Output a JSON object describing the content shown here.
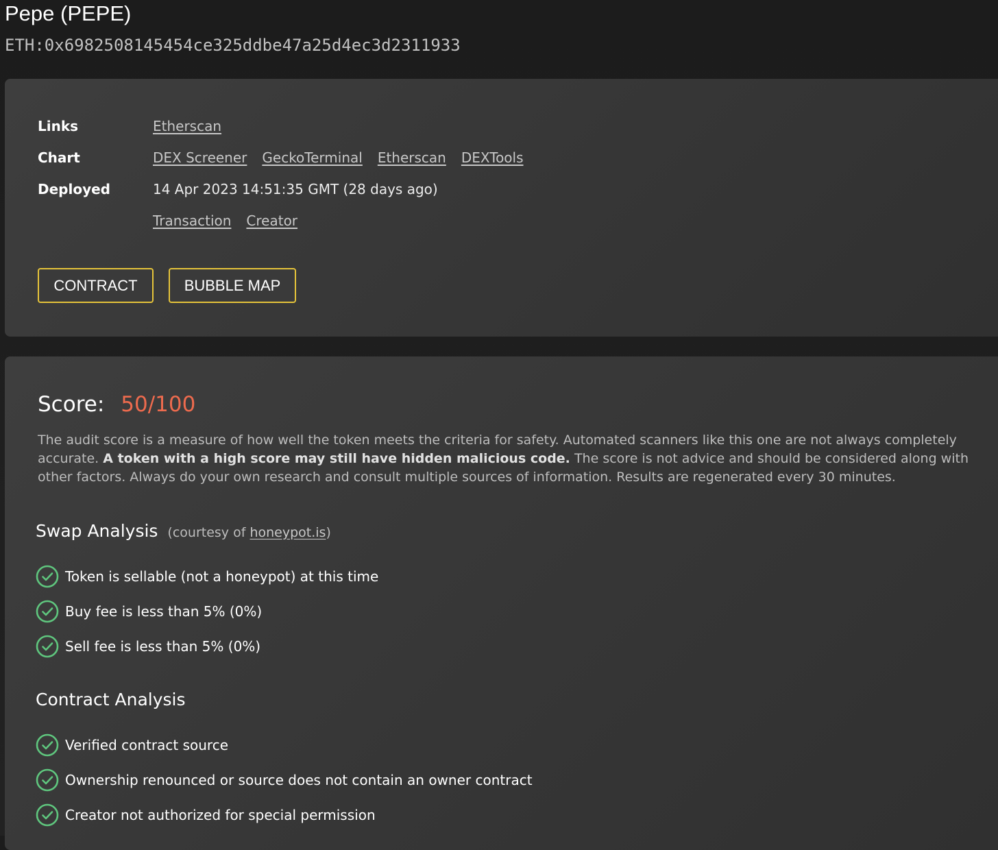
{
  "header": {
    "title": "Pepe (PEPE)",
    "address": "ETH:0x6982508145454ce325ddbe47a25d4ec3d2311933"
  },
  "info": {
    "links": {
      "label": "Links",
      "items": [
        "Etherscan"
      ]
    },
    "chart": {
      "label": "Chart",
      "items": [
        "DEX Screener",
        "GeckoTerminal",
        "Etherscan",
        "DEXTools"
      ]
    },
    "deployed": {
      "label": "Deployed",
      "value": "14 Apr 2023 14:51:35 GMT (28 days ago)",
      "links": [
        "Transaction",
        "Creator"
      ]
    }
  },
  "buttons": {
    "contract": "CONTRACT",
    "bubble_map": "BUBBLE MAP"
  },
  "score": {
    "label": "Score:",
    "value": "50/100",
    "value_color": "#ee6b4e"
  },
  "disclaimer": {
    "part1": "The audit score is a measure of how well the token meets the criteria for safety.  Automated scanners like this one are not always completely accurate.",
    "bold": "A token with a high score may still have hidden malicious code.",
    "part2": "The score is not advice and should be considered along with other factors. Always do your own research and consult multiple sources of information.  Results are regenerated every 30 minutes."
  },
  "swap_analysis": {
    "title": "Swap Analysis",
    "courtesy_prefix": "(courtesy of",
    "courtesy_link": "honeypot.is",
    "courtesy_suffix": ")",
    "items": [
      "Token is sellable (not a honeypot) at this time",
      "Buy fee is less than 5% (0%)",
      "Sell fee is less than 5% (0%)"
    ]
  },
  "contract_analysis": {
    "title": "Contract Analysis",
    "items": [
      "Verified contract source",
      "Ownership renounced or source does not contain an owner contract",
      "Creator not authorized for special permission"
    ]
  },
  "icons": {
    "check": "check-circle-icon",
    "check_color": "#5fc67e"
  },
  "colors": {
    "button_border": "#e6c43a",
    "score_value": "#ee6b4e",
    "check_green": "#5fc67e"
  }
}
